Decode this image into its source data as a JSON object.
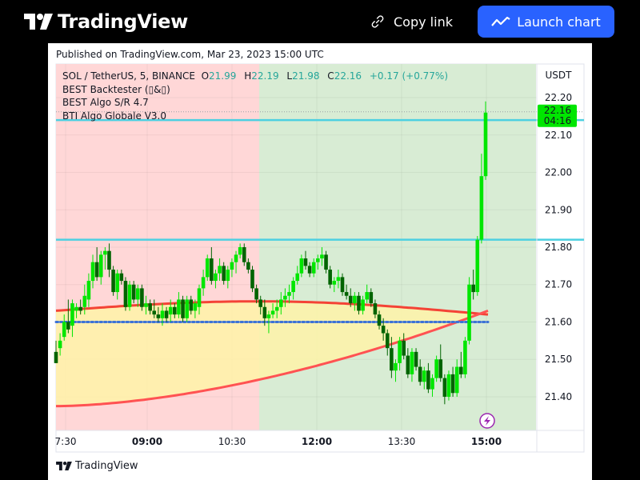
{
  "topbar": {
    "brand": "TradingView",
    "copy_link_label": "Copy link",
    "launch_label": "Launch chart"
  },
  "published": "Published on TradingView.com, Mar 23, 2023 15:00 UTC",
  "legend": {
    "symbol": "SOL / TetherUS, 5, BINANCE",
    "o_label": "O",
    "o_value": "21.99",
    "h_label": "H",
    "h_value": "22.19",
    "l_label": "L",
    "l_value": "21.98",
    "c_label": "C",
    "c_value": "22.16",
    "change": "+0.17 (+0.77%)",
    "indicators": [
      "BEST Backtester (▯&▯)",
      "BEST Algo S/R 4.7",
      "BTI Algo Globale V3.0"
    ]
  },
  "footer_brand": "TradingView",
  "colors": {
    "up": "#00e600",
    "down": "#006400",
    "sr": "#4dd0e1",
    "ma_fast": "#f44336",
    "ma_slow": "#ff5252",
    "dots": "#3d72d6",
    "bg_sell": "#ffd7d7",
    "bg_buy": "#d8ecd4",
    "fill": "#fff3a8"
  },
  "chart_data": {
    "type": "candlestick",
    "x_ticks": [
      "7:30",
      "09:00",
      "10:30",
      "12:00",
      "13:30",
      "15:00"
    ],
    "y_ticks": [
      "22.20",
      "22.10",
      "22.00",
      "21.90",
      "21.80",
      "21.70",
      "21.60",
      "21.50",
      "21.40"
    ],
    "y_unit": "USDT",
    "ylim": [
      21.31,
      22.29
    ],
    "last_price": "22.16",
    "countdown": "04:16",
    "resistance_levels": [
      22.14,
      21.82
    ],
    "support_dotted": 21.6,
    "candles": [
      [
        21.52,
        21.55,
        21.49,
        21.49
      ],
      [
        21.53,
        21.57,
        21.51,
        21.55
      ],
      [
        21.56,
        21.62,
        21.55,
        21.6
      ],
      [
        21.6,
        21.66,
        21.57,
        21.58
      ],
      [
        21.59,
        21.66,
        21.56,
        21.65
      ],
      [
        21.63,
        21.65,
        21.61,
        21.64
      ],
      [
        21.64,
        21.66,
        21.62,
        21.63
      ],
      [
        21.64,
        21.7,
        21.62,
        21.67
      ],
      [
        21.66,
        21.73,
        21.64,
        21.71
      ],
      [
        21.71,
        21.78,
        21.69,
        21.76
      ],
      [
        21.76,
        21.8,
        21.71,
        21.72
      ],
      [
        21.72,
        21.79,
        21.7,
        21.78
      ],
      [
        21.78,
        21.8,
        21.74,
        21.79
      ],
      [
        21.79,
        21.81,
        21.72,
        21.74
      ],
      [
        21.74,
        21.75,
        21.67,
        21.68
      ],
      [
        21.68,
        21.74,
        21.66,
        21.73
      ],
      [
        21.73,
        21.74,
        21.7,
        21.71
      ],
      [
        21.71,
        21.72,
        21.63,
        21.64
      ],
      [
        21.64,
        21.71,
        21.63,
        21.7
      ],
      [
        21.7,
        21.71,
        21.65,
        21.66
      ],
      [
        21.66,
        21.7,
        21.64,
        21.69
      ],
      [
        21.69,
        21.7,
        21.63,
        21.64
      ],
      [
        21.64,
        21.67,
        21.62,
        21.65
      ],
      [
        21.65,
        21.66,
        21.62,
        21.63
      ],
      [
        21.63,
        21.66,
        21.61,
        21.62
      ],
      [
        21.62,
        21.64,
        21.6,
        21.61
      ],
      [
        21.61,
        21.65,
        21.59,
        21.63
      ],
      [
        21.63,
        21.64,
        21.6,
        21.61
      ],
      [
        21.62,
        21.66,
        21.6,
        21.64
      ],
      [
        21.64,
        21.65,
        21.61,
        21.62
      ],
      [
        21.62,
        21.68,
        21.61,
        21.66
      ],
      [
        21.66,
        21.67,
        21.6,
        21.61
      ],
      [
        21.61,
        21.67,
        21.6,
        21.66
      ],
      [
        21.66,
        21.67,
        21.62,
        21.63
      ],
      [
        21.63,
        21.66,
        21.61,
        21.65
      ],
      [
        21.64,
        21.7,
        21.62,
        21.69
      ],
      [
        21.69,
        21.74,
        21.67,
        21.72
      ],
      [
        21.72,
        21.78,
        21.71,
        21.77
      ],
      [
        21.77,
        21.8,
        21.7,
        21.71
      ],
      [
        21.71,
        21.74,
        21.69,
        21.73
      ],
      [
        21.73,
        21.77,
        21.71,
        21.75
      ],
      [
        21.75,
        21.76,
        21.7,
        21.71
      ],
      [
        21.71,
        21.75,
        21.69,
        21.74
      ],
      [
        21.74,
        21.77,
        21.72,
        21.76
      ],
      [
        21.76,
        21.79,
        21.73,
        21.78
      ],
      [
        21.78,
        21.81,
        21.77,
        21.8
      ],
      [
        21.8,
        21.81,
        21.75,
        21.76
      ],
      [
        21.76,
        21.77,
        21.73,
        21.74
      ],
      [
        21.74,
        21.75,
        21.68,
        21.69
      ],
      [
        21.69,
        21.7,
        21.65,
        21.66
      ],
      [
        21.66,
        21.67,
        21.62,
        21.64
      ],
      [
        21.64,
        21.66,
        21.59,
        21.61
      ],
      [
        21.61,
        21.63,
        21.57,
        21.62
      ],
      [
        21.62,
        21.65,
        21.61,
        21.63
      ],
      [
        21.63,
        21.66,
        21.61,
        21.64
      ],
      [
        21.64,
        21.68,
        21.62,
        21.66
      ],
      [
        21.66,
        21.69,
        21.64,
        21.67
      ],
      [
        21.67,
        21.7,
        21.65,
        21.68
      ],
      [
        21.68,
        21.72,
        21.66,
        21.71
      ],
      [
        21.71,
        21.75,
        21.7,
        21.73
      ],
      [
        21.73,
        21.78,
        21.72,
        21.77
      ],
      [
        21.77,
        21.79,
        21.74,
        21.75
      ],
      [
        21.75,
        21.76,
        21.72,
        21.73
      ],
      [
        21.73,
        21.77,
        21.72,
        21.76
      ],
      [
        21.76,
        21.78,
        21.74,
        21.77
      ],
      [
        21.77,
        21.8,
        21.75,
        21.78
      ],
      [
        21.78,
        21.79,
        21.73,
        21.74
      ],
      [
        21.74,
        21.75,
        21.69,
        21.7
      ],
      [
        21.7,
        21.72,
        21.68,
        21.71
      ],
      [
        21.71,
        21.74,
        21.69,
        21.72
      ],
      [
        21.72,
        21.73,
        21.67,
        21.68
      ],
      [
        21.68,
        21.7,
        21.66,
        21.67
      ],
      [
        21.67,
        21.69,
        21.64,
        21.65
      ],
      [
        21.65,
        21.68,
        21.63,
        21.67
      ],
      [
        21.67,
        21.68,
        21.62,
        21.63
      ],
      [
        21.63,
        21.67,
        21.62,
        21.66
      ],
      [
        21.66,
        21.7,
        21.65,
        21.68
      ],
      [
        21.68,
        21.69,
        21.64,
        21.65
      ],
      [
        21.65,
        21.66,
        21.61,
        21.62
      ],
      [
        21.62,
        21.63,
        21.58,
        21.59
      ],
      [
        21.59,
        21.61,
        21.55,
        21.57
      ],
      [
        21.57,
        21.58,
        21.51,
        21.53
      ],
      [
        21.53,
        21.56,
        21.45,
        21.47
      ],
      [
        21.47,
        21.5,
        21.44,
        21.49
      ],
      [
        21.49,
        21.56,
        21.47,
        21.55
      ],
      [
        21.55,
        21.57,
        21.5,
        21.51
      ],
      [
        21.51,
        21.53,
        21.45,
        21.46
      ],
      [
        21.46,
        21.53,
        21.44,
        21.52
      ],
      [
        21.52,
        21.53,
        21.47,
        21.48
      ],
      [
        21.48,
        21.5,
        21.43,
        21.44
      ],
      [
        21.44,
        21.48,
        21.42,
        21.47
      ],
      [
        21.47,
        21.49,
        21.41,
        21.42
      ],
      [
        21.42,
        21.46,
        21.4,
        21.45
      ],
      [
        21.45,
        21.51,
        21.44,
        21.5
      ],
      [
        21.5,
        21.54,
        21.44,
        21.45
      ],
      [
        21.45,
        21.46,
        21.38,
        21.4
      ],
      [
        21.4,
        21.47,
        21.39,
        21.46
      ],
      [
        21.46,
        21.48,
        21.4,
        21.41
      ],
      [
        21.41,
        21.5,
        21.4,
        21.48
      ],
      [
        21.48,
        21.52,
        21.45,
        21.46
      ],
      [
        21.46,
        21.56,
        21.45,
        21.55
      ],
      [
        21.55,
        21.72,
        21.54,
        21.7
      ],
      [
        21.7,
        21.74,
        21.66,
        21.68
      ],
      [
        21.68,
        21.83,
        21.67,
        21.82
      ],
      [
        21.82,
        22.05,
        21.81,
        21.99
      ],
      [
        21.99,
        22.19,
        21.98,
        22.16
      ]
    ]
  }
}
